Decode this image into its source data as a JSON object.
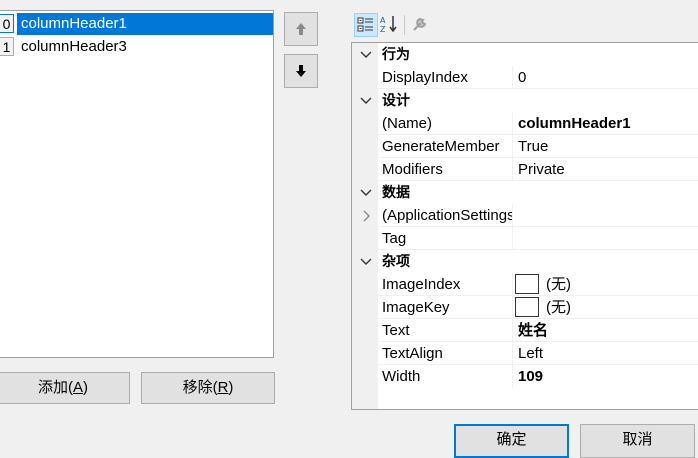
{
  "members": {
    "items": [
      {
        "index": "0",
        "name": "columnHeader1",
        "selected": true
      },
      {
        "index": "1",
        "name": "columnHeader3",
        "selected": false
      }
    ]
  },
  "move_buttons": {
    "up_icon": "arrow-up-icon",
    "down_icon": "arrow-down-icon"
  },
  "buttons": {
    "add_label": "添加(",
    "add_key": "A",
    "add_close": ")",
    "remove_label": "移除(",
    "remove_key": "R",
    "remove_close": ")",
    "ok_label": "确定",
    "cancel_label": "取消"
  },
  "toolbar": {
    "categorized_icon": "categorized-icon",
    "alphabetical_icon": "alphabetical-icon",
    "property_pages_icon": "wrench-icon"
  },
  "grid": {
    "cat_behavior": "行为",
    "display_index_name": "DisplayIndex",
    "display_index_value": "0",
    "cat_design": "设计",
    "name_name": "(Name)",
    "name_value": "columnHeader1",
    "generate_member_name": "GenerateMember",
    "generate_member_value": "True",
    "modifiers_name": "Modifiers",
    "modifiers_value": "Private",
    "cat_data": "数据",
    "app_settings_name": "(ApplicationSettings)",
    "app_settings_value": "",
    "tag_name": "Tag",
    "tag_value": "",
    "cat_misc": "杂项",
    "image_index_name": "ImageIndex",
    "image_index_value": "(无)",
    "image_key_name": "ImageKey",
    "image_key_value": "(无)",
    "text_name": "Text",
    "text_value": "姓名",
    "text_align_name": "TextAlign",
    "text_align_value": "Left",
    "width_name": "Width",
    "width_value": "109"
  },
  "colors": {
    "selection": "#0078d7",
    "toolbar_active": "#cce8ff"
  }
}
